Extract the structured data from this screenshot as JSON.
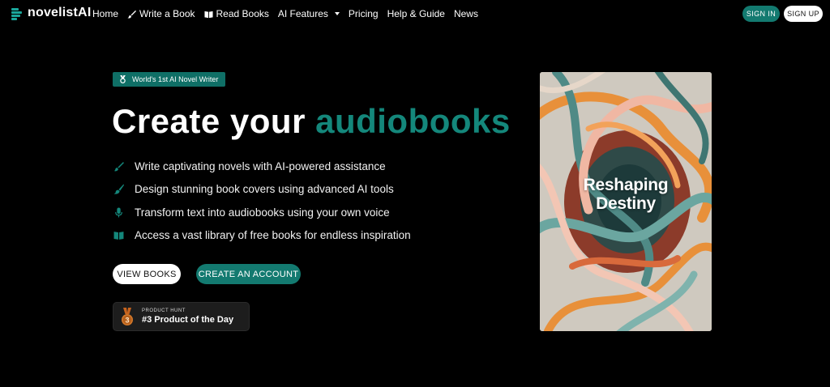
{
  "brand": {
    "name": "novelistAI",
    "accent_color": "#1aa79b"
  },
  "nav": {
    "links": [
      {
        "label": "Home",
        "icon": ""
      },
      {
        "label": "Write a Book",
        "icon": "brush-icon"
      },
      {
        "label": "Read Books",
        "icon": "open-book-icon"
      },
      {
        "label": "AI Features",
        "icon": "chevron-down-icon"
      },
      {
        "label": "Pricing",
        "icon": ""
      },
      {
        "label": "Help & Guide",
        "icon": ""
      },
      {
        "label": "News",
        "icon": ""
      }
    ],
    "sign_in": "SIGN IN",
    "sign_up": "SIGN UP"
  },
  "hero": {
    "badge": "World's 1st AI Novel Writer",
    "badge_icon": "medal-icon",
    "title_prefix": "Create your ",
    "title_accent": "audiobooks",
    "features": [
      {
        "text": "Write captivating novels with AI-powered assistance",
        "icon": "brush-icon"
      },
      {
        "text": "Design stunning book covers using advanced AI tools",
        "icon": "paintbrush-icon"
      },
      {
        "text": "Transform text into audiobooks using your own voice",
        "icon": "microphone-icon"
      },
      {
        "text": "Access a vast library of free books for endless inspiration",
        "icon": "open-book-icon"
      }
    ],
    "view_books": "VIEW BOOKS",
    "create_account": "CREATE AN ACCOUNT"
  },
  "product_hunt": {
    "kicker": "PRODUCT HUNT",
    "title": "#3 Product of the Day",
    "rank": "3"
  },
  "book_cover": {
    "title_line1": "Reshaping",
    "title_line2": "Destiny"
  },
  "colors": {
    "background": "#000000",
    "teal": "#137a70",
    "accent_text": "#14877b"
  }
}
